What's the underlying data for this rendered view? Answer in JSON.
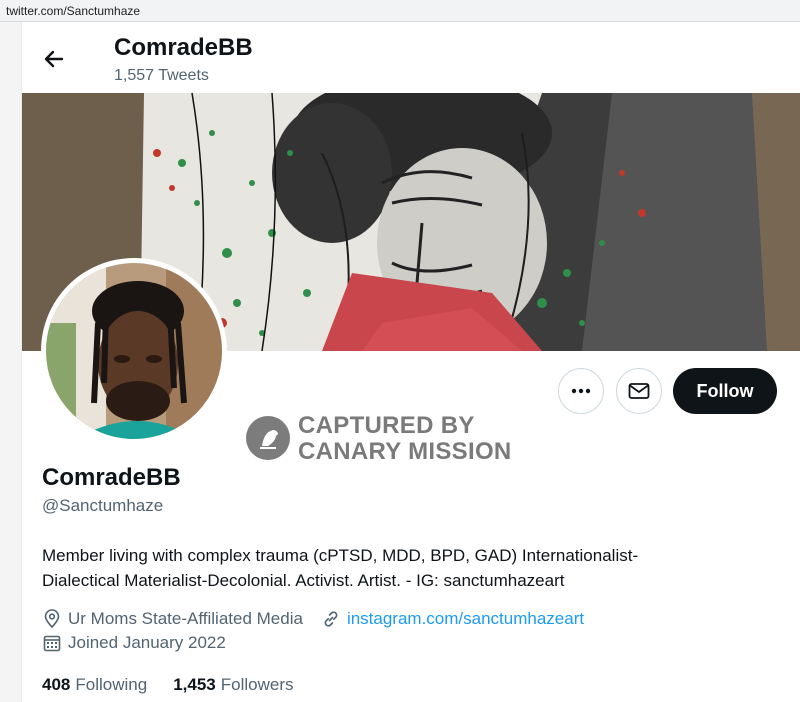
{
  "browser": {
    "url": "twitter.com/Sanctumhaze"
  },
  "header": {
    "name": "ComradeBB",
    "tweet_count": "1,557 Tweets"
  },
  "actions": {
    "follow_label": "Follow"
  },
  "watermark": {
    "line1": "CAPTURED BY",
    "line2": "CANARY MISSION"
  },
  "profile": {
    "name": "ComradeBB",
    "handle": "@Sanctumhaze",
    "bio_line1": "Member living with complex trauma (cPTSD, MDD, BPD, GAD) Internationalist-",
    "bio_line2": "Dialectical Materialist-Decolonial. Activist. Artist. - IG: sanctumhazeart",
    "location": "Ur Moms State-Affiliated Media",
    "website": "instagram.com/sanctumhazeart",
    "joined": "Joined January 2022"
  },
  "stats": {
    "following_count": "408",
    "following_label": "Following",
    "followers_count": "1,453",
    "followers_label": "Followers"
  },
  "colors": {
    "accent": "#1d9bf0",
    "text": "#0f1419",
    "secondary": "#536471",
    "follow_bg": "#0f1419"
  },
  "icons": [
    "back-arrow-icon",
    "more-icon",
    "mail-icon",
    "location-pin-icon",
    "link-icon",
    "calendar-icon",
    "canary-bird-icon"
  ]
}
